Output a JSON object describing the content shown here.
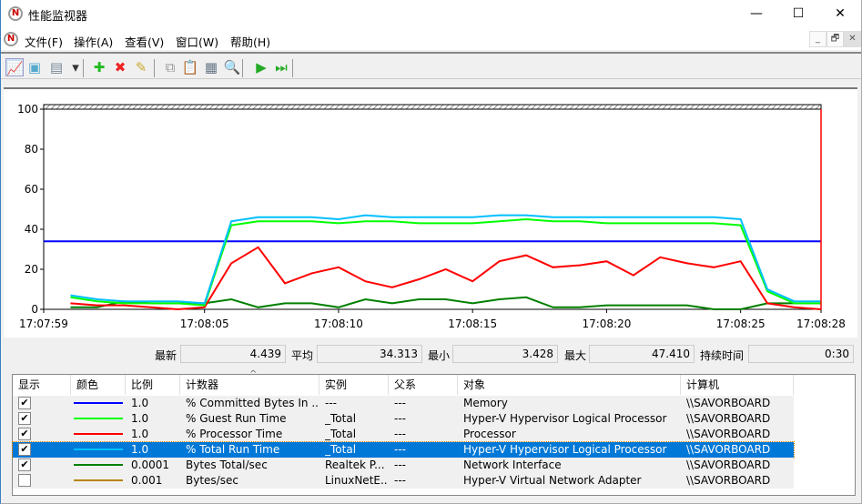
{
  "window": {
    "title": "性能监视器",
    "minimize": "—",
    "maximize": "☐",
    "close": "✕"
  },
  "menu": [
    "文件(F)",
    "操作(A)",
    "查看(V)",
    "窗口(W)",
    "帮助(H)"
  ],
  "mdi_controls": [
    "_",
    "🗗",
    "✕"
  ],
  "toolbar": [
    {
      "icon": "graph-view-icon",
      "glyph": "📈",
      "color": "#3a7"
    },
    {
      "icon": "histogram-icon",
      "glyph": "▣",
      "color": "#5ac"
    },
    {
      "icon": "report-view-icon",
      "glyph": "▤",
      "color": "#789"
    },
    {
      "icon": "dropdown-arrow-icon",
      "glyph": "▾",
      "color": "#333"
    },
    {
      "icon": "add-counter-icon",
      "glyph": "✚",
      "color": "#2b2"
    },
    {
      "icon": "delete-counter-icon",
      "glyph": "✖",
      "color": "#e22"
    },
    {
      "icon": "highlight-icon",
      "glyph": "✎",
      "color": "#ca3"
    },
    {
      "icon": "copy-properties-icon",
      "glyph": "⧉",
      "color": "#999"
    },
    {
      "icon": "paste-counter-list-icon",
      "glyph": "📋",
      "color": "#864"
    },
    {
      "icon": "properties-icon",
      "glyph": "▦",
      "color": "#678"
    },
    {
      "icon": "zoom-icon",
      "glyph": "🔍",
      "color": "#999"
    },
    {
      "icon": "unfreeze-display-icon",
      "glyph": "▶",
      "color": "#2a2"
    },
    {
      "icon": "update-data-icon",
      "glyph": "⏭",
      "color": "#2a2"
    }
  ],
  "stats": {
    "last_label": "最新",
    "last": "4.439",
    "avg_label": "平均",
    "avg": "34.313",
    "min_label": "最小",
    "min": "3.428",
    "max_label": "最大",
    "max": "47.410",
    "dur_label": "持续时间",
    "dur": "0:30"
  },
  "table": {
    "headers": [
      "显示",
      "颜色",
      "比例",
      "计数器",
      "实例",
      "父系",
      "对象",
      "计算机"
    ],
    "rows": [
      {
        "checked": true,
        "color": "#0000ff",
        "scale": "1.0",
        "counter": "% Committed Bytes In ...",
        "instance": "---",
        "parent": "---",
        "object": "Memory",
        "computer": "\\\\SAVORBOARD",
        "selected": false
      },
      {
        "checked": true,
        "color": "#00ff00",
        "scale": "1.0",
        "counter": "% Guest Run Time",
        "instance": "_Total",
        "parent": "---",
        "object": "Hyper-V Hypervisor Logical Processor",
        "computer": "\\\\SAVORBOARD",
        "selected": false
      },
      {
        "checked": true,
        "color": "#ff0000",
        "scale": "1.0",
        "counter": "% Processor Time",
        "instance": "_Total",
        "parent": "---",
        "object": "Processor",
        "computer": "\\\\SAVORBOARD",
        "selected": false
      },
      {
        "checked": true,
        "color": "#00bfff",
        "scale": "1.0",
        "counter": "% Total Run Time",
        "instance": "_Total",
        "parent": "---",
        "object": "Hyper-V Hypervisor Logical Processor",
        "computer": "\\\\SAVORBOARD",
        "selected": true
      },
      {
        "checked": true,
        "color": "#008000",
        "scale": "0.0001",
        "counter": "Bytes Total/sec",
        "instance": "Realtek P...",
        "parent": "---",
        "object": "Network Interface",
        "computer": "\\\\SAVORBOARD",
        "selected": false
      },
      {
        "checked": false,
        "color": "#b8860b",
        "scale": "0.001",
        "counter": "Bytes/sec",
        "instance": "LinuxNetE...",
        "parent": "---",
        "object": "Hyper-V Virtual Network Adapter",
        "computer": "\\\\SAVORBOARD",
        "selected": false
      }
    ]
  },
  "chart_data": {
    "type": "line",
    "ylim": [
      0,
      100
    ],
    "yticks": [
      "0",
      "20",
      "40",
      "60",
      "80",
      "100"
    ],
    "xticks": [
      {
        "label": "17:07:59",
        "t": 0
      },
      {
        "label": "17:08:05",
        "t": 6
      },
      {
        "label": "17:08:10",
        "t": 11
      },
      {
        "label": "17:08:15",
        "t": 16
      },
      {
        "label": "17:08:20",
        "t": 21
      },
      {
        "label": "17:08:25",
        "t": 26
      },
      {
        "label": "17:08:28",
        "t": 29
      }
    ],
    "xlim": [
      0,
      29
    ],
    "x": [
      1,
      2,
      3,
      4,
      5,
      6,
      7,
      8,
      9,
      10,
      11,
      12,
      13,
      14,
      15,
      16,
      17,
      18,
      19,
      20,
      21,
      22,
      23,
      24,
      25,
      26,
      27,
      28,
      29
    ],
    "series": [
      {
        "name": "% Committed Bytes In Use",
        "color": "#0000ff",
        "values": [
          34,
          34,
          34,
          34,
          34,
          34,
          34,
          34,
          34,
          34,
          34,
          34,
          34,
          34,
          34,
          34,
          34,
          34,
          34,
          34,
          34,
          34,
          34,
          34,
          34,
          34,
          34,
          34,
          34
        ],
        "full": true
      },
      {
        "name": "Bytes Total/sec",
        "color": "#008000",
        "values": [
          1,
          1,
          4,
          3,
          3,
          3,
          5,
          1,
          3,
          3,
          1,
          5,
          3,
          5,
          5,
          3,
          5,
          6,
          1,
          1,
          2,
          2,
          2,
          2,
          0,
          0,
          3,
          3,
          3
        ]
      },
      {
        "name": "% Processor Time",
        "color": "#ff0000",
        "values": [
          3,
          2,
          2,
          1,
          0,
          1,
          23,
          31,
          13,
          18,
          21,
          14,
          11,
          15,
          20,
          14,
          24,
          27,
          21,
          22,
          24,
          17,
          26,
          23,
          21,
          24,
          3,
          1,
          0
        ]
      },
      {
        "name": "% Guest Run Time",
        "color": "#00ff00",
        "values": [
          6,
          4,
          3,
          3,
          3,
          2,
          42,
          44,
          44,
          44,
          43,
          44,
          44,
          43,
          43,
          43,
          44,
          45,
          44,
          44,
          43,
          43,
          43,
          43,
          43,
          42,
          9,
          3,
          3
        ]
      },
      {
        "name": "% Total Run Time",
        "color": "#00bfff",
        "values": [
          7,
          5,
          4,
          4,
          4,
          3,
          44,
          46,
          46,
          46,
          45,
          47,
          46,
          46,
          46,
          46,
          47,
          47,
          46,
          46,
          46,
          46,
          46,
          46,
          46,
          45,
          10,
          4,
          4
        ]
      }
    ]
  }
}
